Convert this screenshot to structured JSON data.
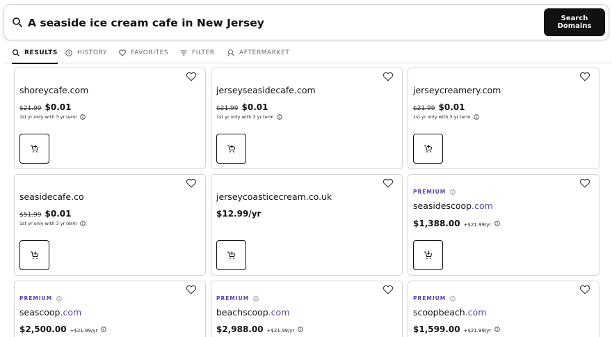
{
  "search": {
    "query": "A seaside ice cream cafe in New Jersey",
    "button_label": "Search Domains"
  },
  "tabs": [
    {
      "label": "RESULTS",
      "icon": "search-icon",
      "active": true
    },
    {
      "label": "HISTORY",
      "icon": "history-icon",
      "active": false
    },
    {
      "label": "FAVORITES",
      "icon": "heart-icon",
      "active": false
    },
    {
      "label": "FILTER",
      "icon": "filter-icon",
      "active": false
    },
    {
      "label": "AFTERMARKET",
      "icon": "aftermarket-icon",
      "active": false
    }
  ],
  "results": [
    {
      "name": "shoreycafe",
      "tld": ".com",
      "premium": false,
      "old_price": "$21.99",
      "price": "$0.01",
      "term": "1st yr only with 3 yr term"
    },
    {
      "name": "jerseyseasidecafe",
      "tld": ".com",
      "premium": false,
      "old_price": "$21.99",
      "price": "$0.01",
      "term": "1st yr only with 3 yr term"
    },
    {
      "name": "jerseycreamery",
      "tld": ".com",
      "premium": false,
      "old_price": "$21.99",
      "price": "$0.01",
      "term": "1st yr only with 3 yr term"
    },
    {
      "name": "seasidecafe",
      "tld": ".co",
      "premium": false,
      "old_price": "$51.99",
      "price": "$0.01",
      "term": "1st yr only with 3 yr term"
    },
    {
      "name": "jerseycoasticecream",
      "tld": ".co.uk",
      "premium": false,
      "old_price": "",
      "price": "$12.99/yr",
      "term": ""
    },
    {
      "name": "seasidescoop",
      "tld": ".com",
      "premium": true,
      "premium_label": "PREMIUM",
      "old_price": "",
      "price": "$1,388.00",
      "renewal": "+$21.99/yr"
    },
    {
      "name": "seascoop",
      "tld": ".com",
      "premium": true,
      "premium_label": "PREMIUM",
      "old_price": "",
      "price": "$2,500.00",
      "renewal": "+$21.99/yr"
    },
    {
      "name": "beachscoop",
      "tld": ".com",
      "premium": true,
      "premium_label": "PREMIUM",
      "old_price": "",
      "price": "$2,988.00",
      "renewal": "+$21.99/yr"
    },
    {
      "name": "scoopbeach",
      "tld": ".com",
      "premium": true,
      "premium_label": "PREMIUM",
      "old_price": "",
      "price": "$1,599.00",
      "renewal": "+$21.99/yr"
    }
  ],
  "colors": {
    "accent": "#5b3fa6",
    "button_bg": "#111111",
    "border": "#d4d4d4"
  }
}
